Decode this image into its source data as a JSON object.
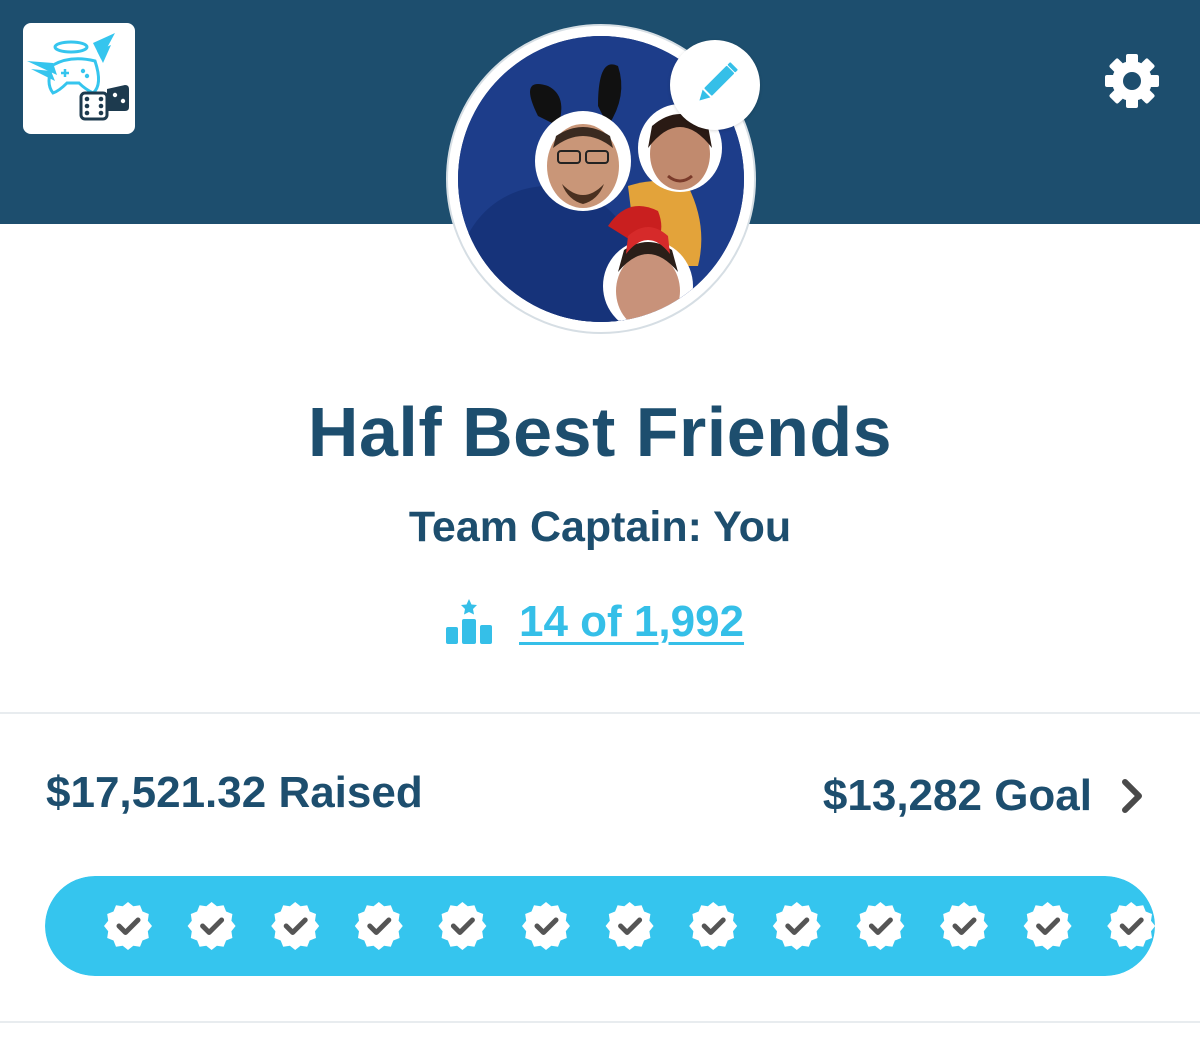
{
  "header": {
    "logo_icon": "game-controller-angel-wings-dice-logo",
    "settings_icon": "gear-icon",
    "edit_icon": "pencil-icon",
    "avatar_icon": "team-avatar-photo",
    "background_color": "#1d4e6e"
  },
  "team": {
    "name": "Half Best Friends",
    "captain": "Team Captain: You",
    "rank_icon": "podium-icon",
    "rank_text": "14 of 1,992"
  },
  "fundraising": {
    "raised_text": "$17,521.32 Raised",
    "goal_text": "$13,282 Goal",
    "goal_chevron_icon": "chevron-right-icon",
    "progress_fraction": 1.0,
    "milestone_count": 13,
    "milestone_icon": "badge-check-icon",
    "milestones_achieved": 13
  },
  "colors": {
    "primary": "#1d4e6e",
    "accent": "#35c5ee",
    "link": "#35bfe8",
    "check": "#555555"
  }
}
